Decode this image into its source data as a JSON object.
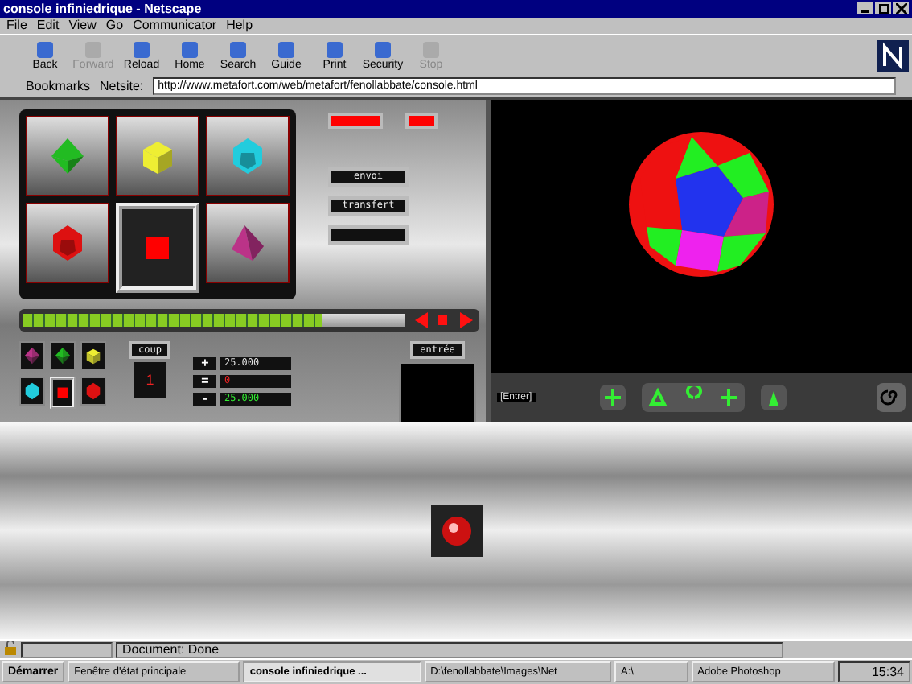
{
  "window": {
    "title": "console infiniedrique - Netscape"
  },
  "menu": [
    "File",
    "Edit",
    "View",
    "Go",
    "Communicator",
    "Help"
  ],
  "toolbar": [
    {
      "label": "Back",
      "disabled": false
    },
    {
      "label": "Forward",
      "disabled": true
    },
    {
      "label": "Reload",
      "disabled": false
    },
    {
      "label": "Home",
      "disabled": false
    },
    {
      "label": "Search",
      "disabled": false
    },
    {
      "label": "Guide",
      "disabled": false
    },
    {
      "label": "Print",
      "disabled": false
    },
    {
      "label": "Security",
      "disabled": false
    },
    {
      "label": "Stop",
      "disabled": true
    }
  ],
  "location": {
    "bookmarks": "Bookmarks",
    "label": "Netsite:",
    "url": "http://www.metafort.com/web/metafort/fenollabbate/console.html"
  },
  "console": {
    "tiles": [
      {
        "kind": "octahedron",
        "color": "#22bb22",
        "selected": false
      },
      {
        "kind": "cube",
        "color": "#eeee33",
        "selected": false
      },
      {
        "kind": "icosahedron",
        "color": "#22ccdd",
        "selected": false
      },
      {
        "kind": "dodecahedron",
        "color": "#dd1111",
        "selected": false
      },
      {
        "kind": "square",
        "color": "#ff0000",
        "selected": true
      },
      {
        "kind": "tetrahedron",
        "color": "#bb3388",
        "selected": false
      }
    ],
    "buttons": [
      "envoi",
      "transfert"
    ],
    "progress": {
      "level": 0.78
    },
    "palette": [
      {
        "kind": "octahedron",
        "color": "#bb3388",
        "selected": false
      },
      {
        "kind": "octahedron",
        "color": "#22bb22",
        "selected": false
      },
      {
        "kind": "cube",
        "color": "#eeee33",
        "selected": false
      },
      {
        "kind": "icosahedron",
        "color": "#22ccdd",
        "selected": false
      },
      {
        "kind": "square",
        "color": "#ff0000",
        "selected": true
      },
      {
        "kind": "dodecahedron",
        "color": "#dd1111",
        "selected": false
      }
    ],
    "counter": {
      "label": "coup",
      "value": "1"
    },
    "sums": [
      {
        "sign": "+",
        "value": "25.000",
        "kind": "plain"
      },
      {
        "sign": "=",
        "value": "0",
        "kind": "alert"
      },
      {
        "sign": "-",
        "value": "25.000",
        "kind": "ok"
      }
    ],
    "entry": {
      "label": "entrée"
    }
  },
  "viewer": {
    "field": "[Entrer]"
  },
  "status_bar": {
    "text": "Document: Done"
  },
  "taskbar": {
    "start": "Démarrer",
    "tasks": [
      {
        "label": "Fenêtre d'état principale",
        "selected": false
      },
      {
        "label": "console infiniedrique ...",
        "selected": true
      },
      {
        "label": "D:\\fenollabbate\\Images\\Net",
        "selected": false
      },
      {
        "label": "A:\\",
        "selected": false
      },
      {
        "label": "Adobe Photoshop",
        "selected": false
      }
    ],
    "clock": "15:34"
  }
}
